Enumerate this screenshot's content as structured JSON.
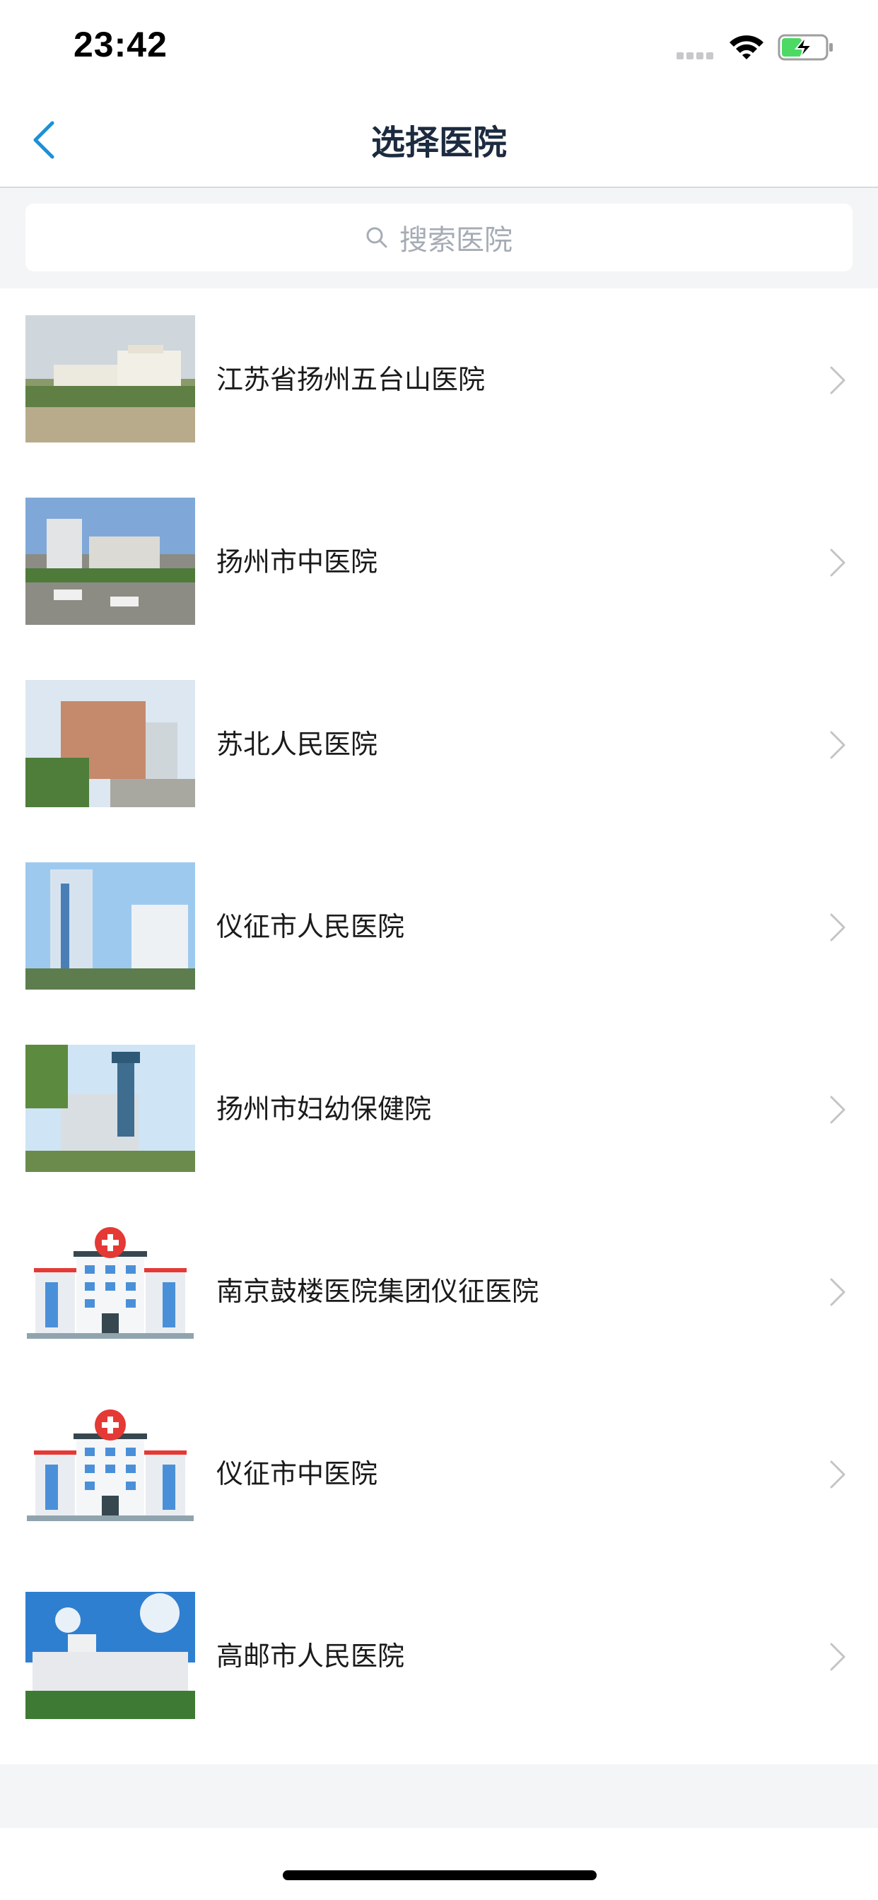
{
  "status_bar": {
    "time": "23:42"
  },
  "nav": {
    "title": "选择医院"
  },
  "search": {
    "placeholder": "搜索医院"
  },
  "hospitals": [
    {
      "name": "江苏省扬州五台山医院",
      "thumb": "photo"
    },
    {
      "name": "扬州市中医院",
      "thumb": "photo"
    },
    {
      "name": "苏北人民医院",
      "thumb": "photo"
    },
    {
      "name": "仪征市人民医院",
      "thumb": "photo"
    },
    {
      "name": "扬州市妇幼保健院",
      "thumb": "photo"
    },
    {
      "name": "南京鼓楼医院集团仪征医院",
      "thumb": "hospital-icon"
    },
    {
      "name": "仪征市中医院",
      "thumb": "hospital-icon"
    },
    {
      "name": "高邮市人民医院",
      "thumb": "photo"
    }
  ],
  "colors": {
    "accent": "#1e8fd8",
    "background": "#f4f5f7",
    "title": "#1c2b3f",
    "placeholder": "#a6acb5",
    "chevron": "#c4c4c4"
  }
}
